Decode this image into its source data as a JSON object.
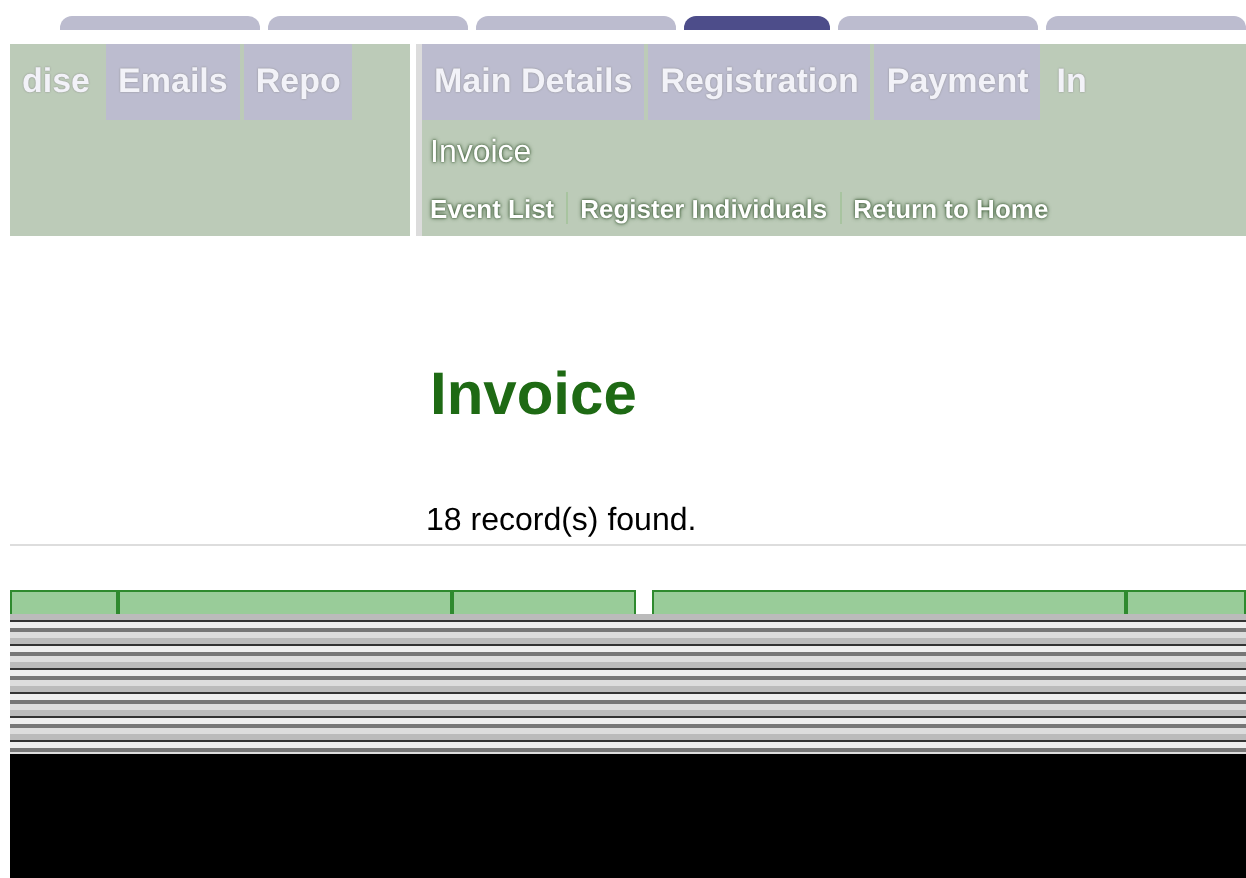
{
  "back_tabs": [
    {
      "label": "dise",
      "selected": true
    },
    {
      "label": "Emails",
      "selected": false
    },
    {
      "label": "Repo",
      "selected": false
    }
  ],
  "tabs": [
    {
      "label": "Main Details",
      "selected": false
    },
    {
      "label": "Registration",
      "selected": false
    },
    {
      "label": "Payment",
      "selected": false
    },
    {
      "label": "In",
      "selected": true
    }
  ],
  "subheader": {
    "title": "Invoice",
    "links": [
      "Event List",
      "Register Individuals",
      "Return to Home"
    ]
  },
  "heading": "Invoice",
  "record_count": "18 record(s) found."
}
